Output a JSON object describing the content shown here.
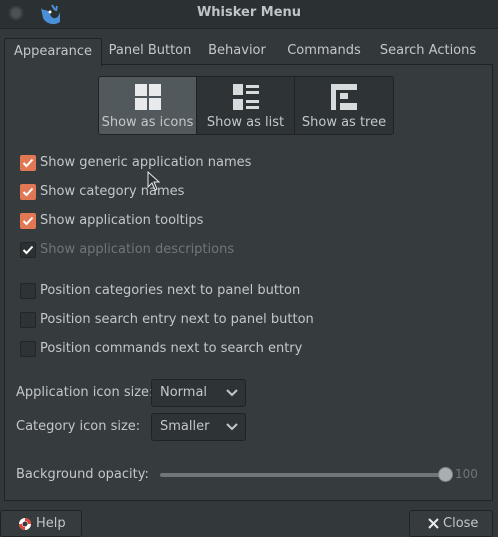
{
  "window": {
    "title": "Whisker Menu"
  },
  "tabs": [
    {
      "label": "Appearance",
      "active": true
    },
    {
      "label": "Panel Button"
    },
    {
      "label": "Behavior"
    },
    {
      "label": "Commands"
    },
    {
      "label": "Search Actions"
    }
  ],
  "view_modes": [
    {
      "label": "Show as icons",
      "icon": "grid-icon",
      "selected": true
    },
    {
      "label": "Show as list",
      "icon": "list-icon"
    },
    {
      "label": "Show as tree",
      "icon": "tree-icon"
    }
  ],
  "checkboxes": [
    {
      "label": "Show generic application names",
      "checked": true
    },
    {
      "label": "Show category names",
      "checked": true
    },
    {
      "label": "Show application tooltips",
      "checked": true
    },
    {
      "label": "Show application descriptions",
      "checked": true,
      "disabled": true
    },
    {
      "label": "Position categories next to panel button",
      "checked": false
    },
    {
      "label": "Position search entry next to panel button",
      "checked": false
    },
    {
      "label": "Position commands next to search entry",
      "checked": false
    }
  ],
  "fields": {
    "app_icon_size": {
      "label": "Application icon size:",
      "value": "Normal"
    },
    "category_icon_size": {
      "label": "Category icon size:",
      "value": "Smaller"
    },
    "background_opacity": {
      "label": "Background opacity:",
      "value": "100",
      "fraction": 1.0
    }
  },
  "buttons": {
    "help": "Help",
    "close": "Close"
  },
  "colors": {
    "accent": "#e17753",
    "background": "#33393b"
  }
}
